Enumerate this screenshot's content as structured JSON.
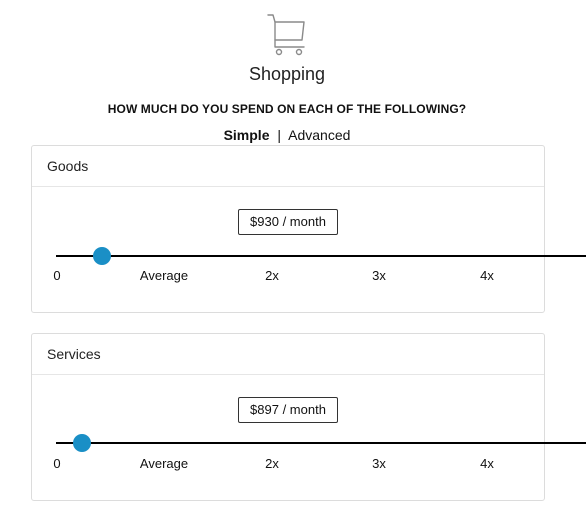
{
  "header": {
    "icon": "shopping-cart-icon",
    "title": "Shopping",
    "question": "HOW MUCH DO YOU SPEND ON EACH OF THE FOLLOWING?",
    "mode_simple": "Simple",
    "mode_separator": "|",
    "mode_advanced": "Advanced"
  },
  "panels": {
    "goods": {
      "title": "Goods",
      "value_label": "$930 / month",
      "ticks": [
        "0",
        "Average",
        "2x",
        "3x",
        "4x"
      ],
      "slider_position_fraction": 0.42
    },
    "services": {
      "title": "Services",
      "value_label": "$897 / month",
      "ticks": [
        "0",
        "Average",
        "2x",
        "3x",
        "4x"
      ],
      "slider_position_fraction": 0.23
    }
  },
  "colors": {
    "accent": "#1a8fc6",
    "track": "#000000",
    "border": "#dcdcdc"
  }
}
